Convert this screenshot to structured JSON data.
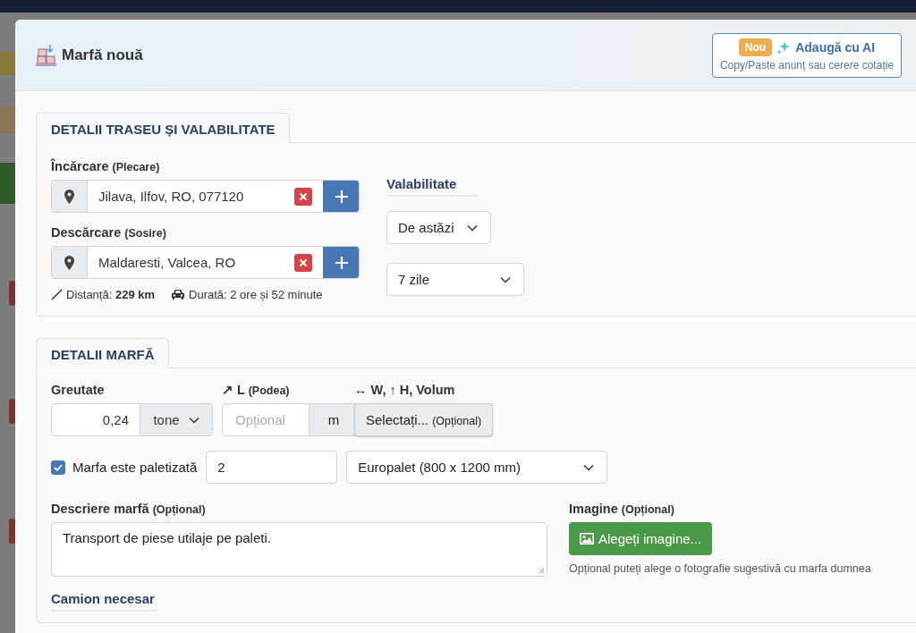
{
  "modal": {
    "title": "Marfă nouă",
    "ai_button": {
      "badge": "Nou",
      "label": "Adaugă cu AI",
      "subtitle": "Copy/Paste anunț sau cerere cotație"
    }
  },
  "route_section": {
    "title": "DETALII TRASEU ȘI VALABILITATE",
    "locations": [
      {
        "label": "Încărcare",
        "hint": "(Plecare)",
        "value": "Jilava, Ilfov, RO, 077120"
      },
      {
        "label": "Descărcare",
        "hint": "(Sosire)",
        "value": "Maldaresti, Valcea, RO"
      }
    ],
    "distance": {
      "label": "Distanță:",
      "value": "229 km"
    },
    "duration": "Durată: 2 ore și 52 minute",
    "validity": {
      "title": "Valabilitate",
      "start": "De astăzi",
      "period": "7 zile"
    }
  },
  "cargo_section": {
    "title": "DETALII MARFĂ",
    "weight": {
      "label": "Greutate",
      "value": "0,24",
      "unit": "tone"
    },
    "length": {
      "label": "↗ L",
      "hint": "(Podea)",
      "placeholder": "Opțional",
      "unit": "m"
    },
    "dimensions": {
      "label": "↔ W, ↑ H, Volum",
      "button": "Selectați...",
      "hint": "(Opțional)"
    },
    "palletized": {
      "label": "Marfa este paletizată",
      "checked": true,
      "count": "2",
      "pallet_type": "Europalet (800 x 1200 mm)"
    },
    "description": {
      "label": "Descriere marfă",
      "hint": "(Opțional)",
      "value": "Transport de piese utilaje pe paleti."
    },
    "image": {
      "label": "Imagine",
      "hint": "(Opțional)",
      "button": "Alegeți imagine...",
      "help": "Opțional puteți alege o fotografie sugestivă cu marfa dumnea"
    },
    "truck_title": "Camion necesar"
  }
}
